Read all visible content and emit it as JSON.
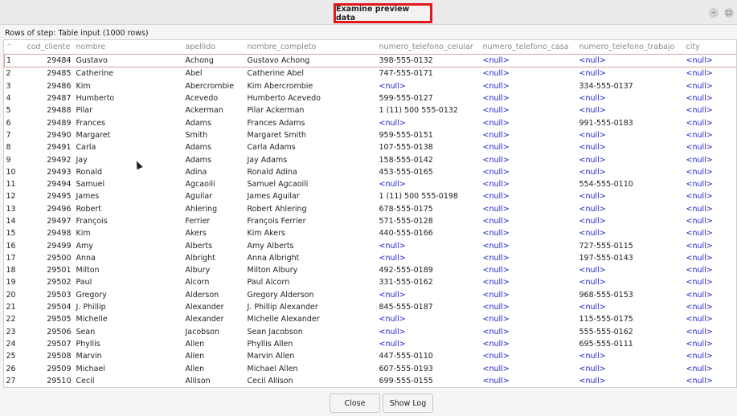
{
  "window": {
    "title": "Examine preview data",
    "minimize_icon": "minimize-icon",
    "maximize_icon": "maximize-icon"
  },
  "info": {
    "rows_label": "Rows of step: Table input (1000 rows)"
  },
  "table": {
    "sort_glyph": "^",
    "columns": [
      "cod_cliente",
      "nombre",
      "apellido",
      "nombre_completo",
      "numero_telefono_celular",
      "numero_telefono_casa",
      "numero_telefono_trabajo",
      "city"
    ],
    "rows": [
      [
        "1",
        "29484",
        "Gustavo",
        "Achong",
        "Gustavo Achong",
        "398-555-0132",
        "<null>",
        "<null>",
        "<null>"
      ],
      [
        "2",
        "29485",
        "Catherine",
        "Abel",
        "Catherine Abel",
        "747-555-0171",
        "<null>",
        "<null>",
        "<null>"
      ],
      [
        "3",
        "29486",
        "Kim",
        "Abercrombie",
        "Kim Abercrombie",
        "<null>",
        "<null>",
        "334-555-0137",
        "<null>"
      ],
      [
        "4",
        "29487",
        "Humberto",
        "Acevedo",
        "Humberto Acevedo",
        "599-555-0127",
        "<null>",
        "<null>",
        "<null>"
      ],
      [
        "5",
        "29488",
        "Pilar",
        "Ackerman",
        "Pilar Ackerman",
        "1 (11) 500 555-0132",
        "<null>",
        "<null>",
        "<null>"
      ],
      [
        "6",
        "29489",
        "Frances",
        "Adams",
        "Frances Adams",
        "<null>",
        "<null>",
        "991-555-0183",
        "<null>"
      ],
      [
        "7",
        "29490",
        "Margaret",
        "Smith",
        "Margaret Smith",
        "959-555-0151",
        "<null>",
        "<null>",
        "<null>"
      ],
      [
        "8",
        "29491",
        "Carla",
        "Adams",
        "Carla Adams",
        "107-555-0138",
        "<null>",
        "<null>",
        "<null>"
      ],
      [
        "9",
        "29492",
        "Jay",
        "Adams",
        "Jay Adams",
        "158-555-0142",
        "<null>",
        "<null>",
        "<null>"
      ],
      [
        "10",
        "29493",
        "Ronald",
        "Adina",
        "Ronald Adina",
        "453-555-0165",
        "<null>",
        "<null>",
        "<null>"
      ],
      [
        "11",
        "29494",
        "Samuel",
        "Agcaoili",
        "Samuel Agcaoili",
        "<null>",
        "<null>",
        "554-555-0110",
        "<null>"
      ],
      [
        "12",
        "29495",
        "James",
        "Aguilar",
        "James Aguilar",
        "1 (11) 500 555-0198",
        "<null>",
        "<null>",
        "<null>"
      ],
      [
        "13",
        "29496",
        "Robert",
        "Ahlering",
        "Robert Ahlering",
        "678-555-0175",
        "<null>",
        "<null>",
        "<null>"
      ],
      [
        "14",
        "29497",
        "François",
        "Ferrier",
        "François Ferrier",
        "571-555-0128",
        "<null>",
        "<null>",
        "<null>"
      ],
      [
        "15",
        "29498",
        "Kim",
        "Akers",
        "Kim Akers",
        "440-555-0166",
        "<null>",
        "<null>",
        "<null>"
      ],
      [
        "16",
        "29499",
        "Amy",
        "Alberts",
        "Amy Alberts",
        "<null>",
        "<null>",
        "727-555-0115",
        "<null>"
      ],
      [
        "17",
        "29500",
        "Anna",
        "Albright",
        "Anna Albright",
        "<null>",
        "<null>",
        "197-555-0143",
        "<null>"
      ],
      [
        "18",
        "29501",
        "Milton",
        "Albury",
        "Milton Albury",
        "492-555-0189",
        "<null>",
        "<null>",
        "<null>"
      ],
      [
        "19",
        "29502",
        "Paul",
        "Alcorn",
        "Paul Alcorn",
        "331-555-0162",
        "<null>",
        "<null>",
        "<null>"
      ],
      [
        "20",
        "29503",
        "Gregory",
        "Alderson",
        "Gregory Alderson",
        "<null>",
        "<null>",
        "968-555-0153",
        "<null>"
      ],
      [
        "21",
        "29504",
        "J. Phillip",
        "Alexander",
        "J. Phillip Alexander",
        "845-555-0187",
        "<null>",
        "<null>",
        "<null>"
      ],
      [
        "22",
        "29505",
        "Michelle",
        "Alexander",
        "Michelle Alexander",
        "<null>",
        "<null>",
        "115-555-0175",
        "<null>"
      ],
      [
        "23",
        "29506",
        "Sean",
        "Jacobson",
        "Sean Jacobson",
        "<null>",
        "<null>",
        "555-555-0162",
        "<null>"
      ],
      [
        "24",
        "29507",
        "Phyllis",
        "Allen",
        "Phyllis Allen",
        "<null>",
        "<null>",
        "695-555-0111",
        "<null>"
      ],
      [
        "25",
        "29508",
        "Marvin",
        "Allen",
        "Marvin Allen",
        "447-555-0110",
        "<null>",
        "<null>",
        "<null>"
      ],
      [
        "26",
        "29509",
        "Michael",
        "Allen",
        "Michael Allen",
        "607-555-0193",
        "<null>",
        "<null>",
        "<null>"
      ],
      [
        "27",
        "29510",
        "Cecil",
        "Allison",
        "Cecil Allison",
        "699-555-0155",
        "<null>",
        "<null>",
        "<null>"
      ]
    ],
    "selected_row": 0,
    "null_color": "#2222cc"
  },
  "buttons": {
    "close": "Close",
    "show_log": "Show Log"
  },
  "annotation": {
    "highlight_color": "#e3171b"
  }
}
